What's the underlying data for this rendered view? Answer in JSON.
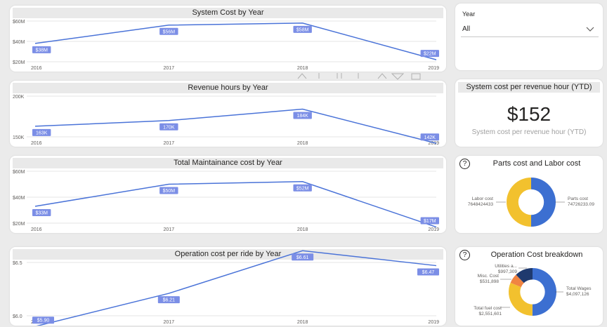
{
  "colors": {
    "line": "#4a73d8",
    "label_bg": "#7b8ee6",
    "label_text": "#ffffff",
    "axis_text": "#605e5c",
    "grid": "#e6e6e6",
    "donut_blue": "#3c6fd1",
    "donut_yellow": "#f2c12e",
    "donut_orange": "#f08442",
    "donut_navy": "#1f3a6e"
  },
  "year_slicer": {
    "label": "Year",
    "value": "All"
  },
  "kpi": {
    "title": "System cost per revenue hour (YTD)",
    "value": "$152",
    "subtitle": "System cost per revenue hour (YTD)"
  },
  "donut1": {
    "title": "Parts cost and Labor cost",
    "help_icon": "?"
  },
  "donut2": {
    "title": "Operation Cost breakdown",
    "help_icon": "?"
  },
  "chart_data": [
    {
      "type": "line",
      "title": "System Cost by Year",
      "x": [
        "2016",
        "2017",
        "2018",
        "2019"
      ],
      "values": [
        38,
        56,
        58,
        22
      ],
      "labels": [
        "$38M",
        "$56M",
        "$58M",
        "$22M"
      ],
      "yticks": [
        "$20M",
        "$40M",
        "$60M"
      ],
      "ytick_values": [
        20,
        40,
        60
      ],
      "ylim": [
        20,
        60
      ]
    },
    {
      "type": "line",
      "title": "Revenue hours by Year",
      "x": [
        "2016",
        "2017",
        "2018",
        "2019"
      ],
      "values": [
        163,
        170,
        184,
        142
      ],
      "labels": [
        "163K",
        "170K",
        "184K",
        "142K"
      ],
      "yticks": [
        "150K",
        "200K"
      ],
      "ytick_values": [
        150,
        200
      ],
      "ylim": [
        150,
        200
      ]
    },
    {
      "type": "line",
      "title": "Total Maintainance cost by Year",
      "x": [
        "2016",
        "2017",
        "2018",
        "2019"
      ],
      "values": [
        33,
        50,
        52,
        17
      ],
      "labels": [
        "$33M",
        "$50M",
        "$52M",
        "$17M"
      ],
      "yticks": [
        "$20M",
        "$40M",
        "$60M"
      ],
      "ytick_values": [
        20,
        40,
        60
      ],
      "ylim": [
        20,
        60
      ]
    },
    {
      "type": "line",
      "title": "Operation cost per ride by Year",
      "x": [
        "2016",
        "2017",
        "2018",
        "2019"
      ],
      "values": [
        5.9,
        6.21,
        6.61,
        6.47
      ],
      "labels": [
        "$5.90",
        "$6.21",
        "$6.61",
        "$6.47"
      ],
      "yticks": [
        "$6.0",
        "$6.5"
      ],
      "ytick_values": [
        6.0,
        6.5
      ],
      "ylim": [
        6.0,
        6.5
      ]
    },
    {
      "type": "pie",
      "title": "Parts cost and Labor cost",
      "categories": [
        "Parts cost",
        "Labor cost"
      ],
      "values": [
        74726233.09,
        7648424433
      ],
      "labels": [
        "74726233.09",
        "7648424433"
      ],
      "shares": [
        0.5,
        0.5
      ]
    },
    {
      "type": "pie",
      "title": "Operation Cost breakdown",
      "categories": [
        "Total Wages",
        "Total fuel cost",
        "Misc. Cost",
        "Utilities a..."
      ],
      "values": [
        4097126,
        2551601,
        531898,
        997309
      ],
      "labels": [
        "$4,097,126",
        "$2,551,601",
        "$531,898",
        "$997,309"
      ]
    }
  ]
}
